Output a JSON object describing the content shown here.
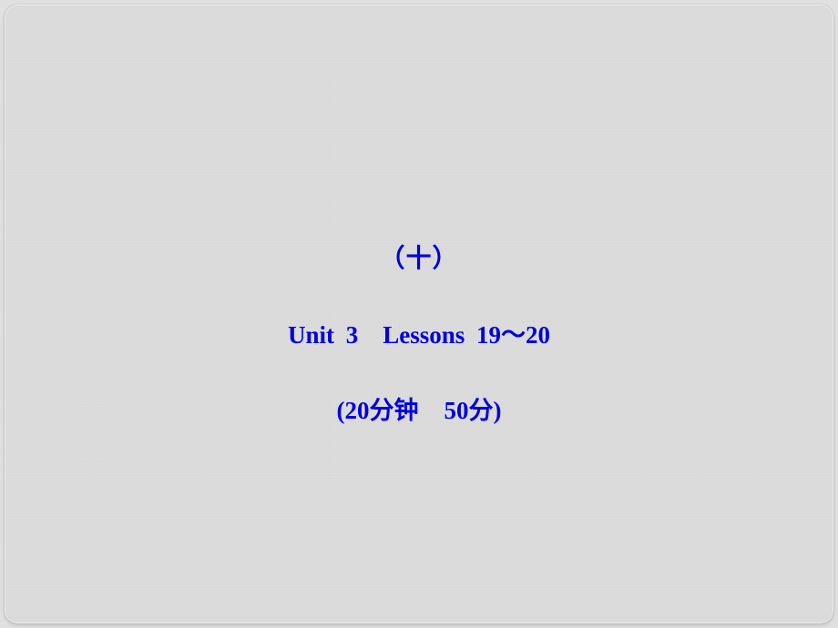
{
  "slide": {
    "number_label": "（十）",
    "unit_line": "Unit 3 Lessons 19～20",
    "time_points_open": "(20",
    "time_unit": "分钟",
    "points": "50",
    "points_unit": "分",
    "close": ")"
  }
}
